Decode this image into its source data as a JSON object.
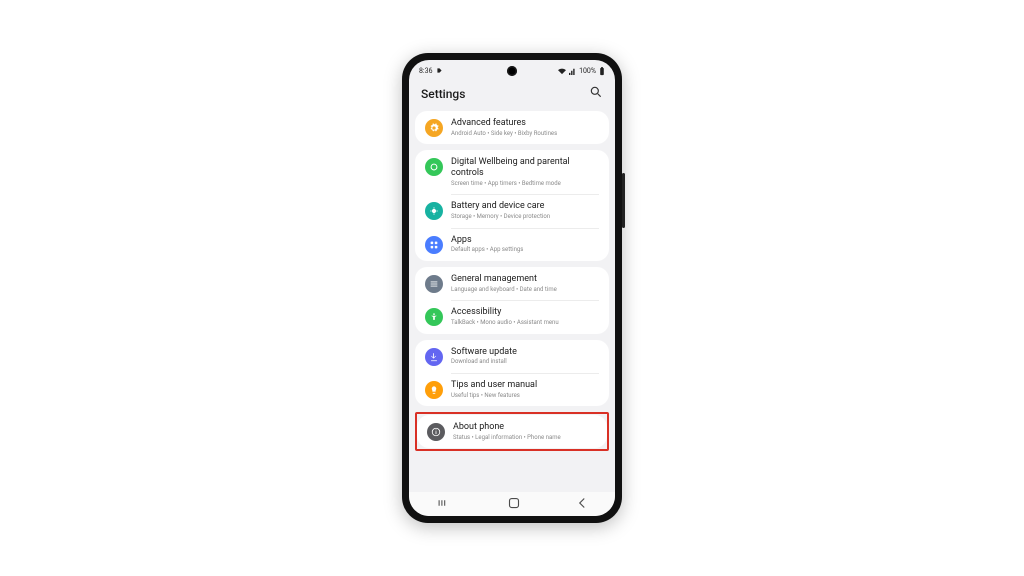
{
  "statusbar": {
    "time": "8:36",
    "battery_text": "100%"
  },
  "header": {
    "title": "Settings"
  },
  "groups": [
    {
      "items": [
        {
          "id": "advanced-features",
          "icon_name": "gear-icon",
          "icon_color": "ic-amber",
          "title": "Advanced features",
          "subtitle": "Android Auto  •  Side key  •  Bixby Routines"
        }
      ]
    },
    {
      "items": [
        {
          "id": "digital-wellbeing",
          "icon_name": "wellbeing-icon",
          "icon_color": "ic-green",
          "title": "Digital Wellbeing and parental controls",
          "subtitle": "Screen time  •  App timers  •  Bedtime mode"
        },
        {
          "id": "battery-device-care",
          "icon_name": "device-care-icon",
          "icon_color": "ic-teal",
          "title": "Battery and device care",
          "subtitle": "Storage  •  Memory  •  Device protection"
        },
        {
          "id": "apps",
          "icon_name": "apps-icon",
          "icon_color": "ic-blue",
          "title": "Apps",
          "subtitle": "Default apps  •  App settings"
        }
      ]
    },
    {
      "items": [
        {
          "id": "general-management",
          "icon_name": "general-icon",
          "icon_color": "ic-slate",
          "title": "General management",
          "subtitle": "Language and keyboard  •  Date and time"
        },
        {
          "id": "accessibility",
          "icon_name": "accessibility-icon",
          "icon_color": "ic-green",
          "title": "Accessibility",
          "subtitle": "TalkBack  •  Mono audio  •  Assistant menu"
        }
      ]
    },
    {
      "items": [
        {
          "id": "software-update",
          "icon_name": "download-icon",
          "icon_color": "ic-purple",
          "title": "Software update",
          "subtitle": "Download and install"
        },
        {
          "id": "tips-manual",
          "icon_name": "lightbulb-icon",
          "icon_color": "ic-orange",
          "title": "Tips and user manual",
          "subtitle": "Useful tips  •  New features"
        }
      ]
    },
    {
      "highlight": true,
      "items": [
        {
          "id": "about-phone",
          "icon_name": "info-icon",
          "icon_color": "ic-darkgrey",
          "title": "About phone",
          "subtitle": "Status  •  Legal information  •  Phone name"
        }
      ]
    }
  ]
}
